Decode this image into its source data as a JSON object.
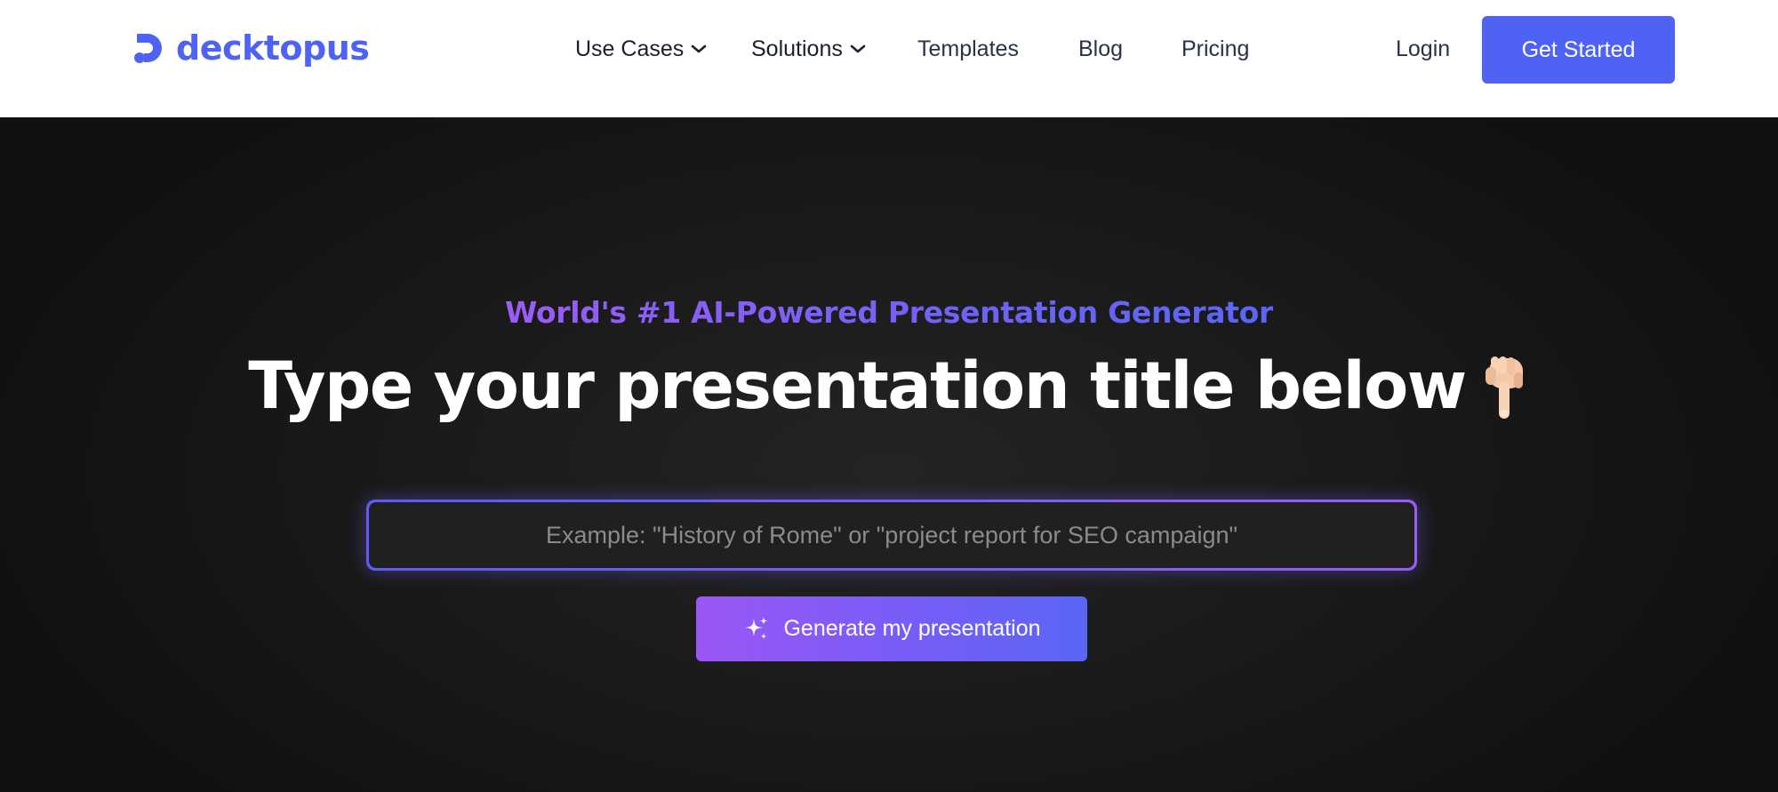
{
  "brand": {
    "name": "decktopus",
    "logo_icon": "decktopus-logo-icon",
    "accent_color": "#4e63f4"
  },
  "nav": {
    "items": [
      {
        "label": "Use Cases",
        "has_dropdown": true
      },
      {
        "label": "Solutions",
        "has_dropdown": true
      },
      {
        "label": "Templates",
        "has_dropdown": false
      },
      {
        "label": "Blog",
        "has_dropdown": false
      },
      {
        "label": "Pricing",
        "has_dropdown": false
      }
    ],
    "login_label": "Login",
    "cta_label": "Get Started"
  },
  "hero": {
    "eyebrow": "World's #1 AI-Powered Presentation Generator",
    "headline": "Type your presentation title below",
    "headline_icon": "pointing-down-hand-icon",
    "input_placeholder": "Example: \"History of Rome\" or \"project report for SEO campaign\"",
    "input_value": "",
    "generate_label": "Generate my presentation",
    "generate_icon": "sparkle-icon",
    "gradient_colors": [
      "#9b57f6",
      "#5a66f6"
    ]
  }
}
